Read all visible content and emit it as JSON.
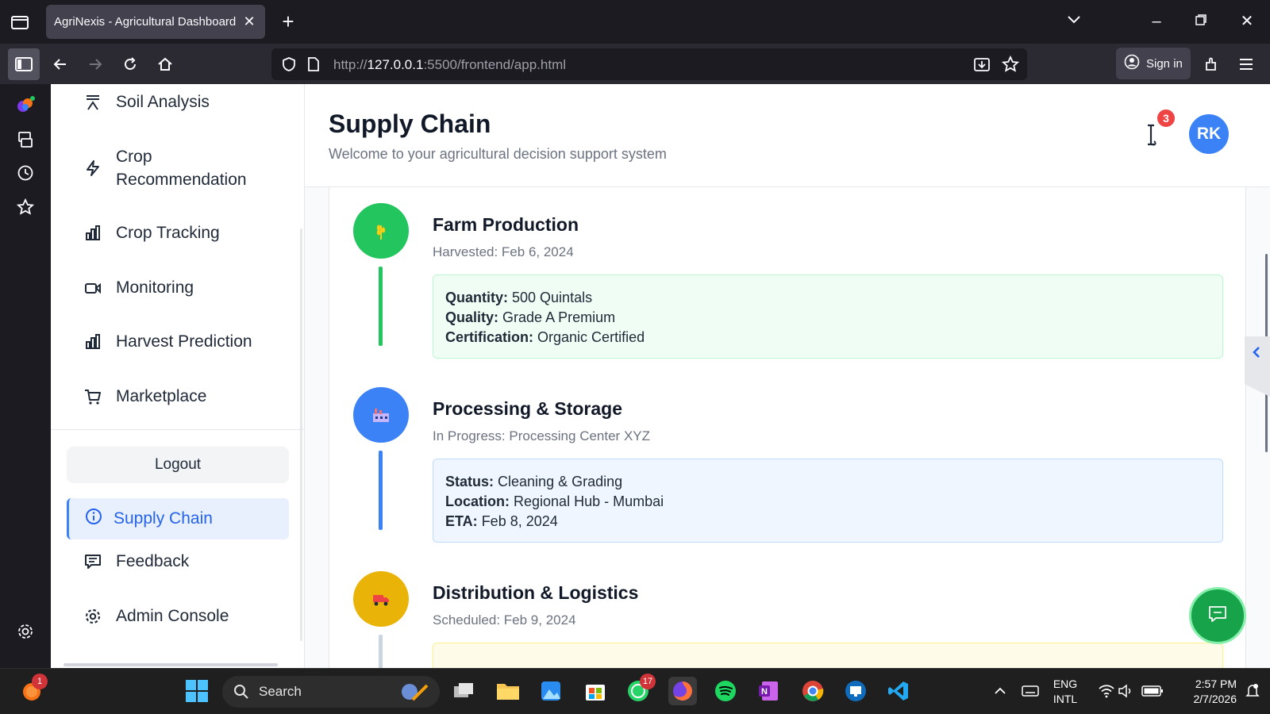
{
  "browser": {
    "tab_title": "AgriNexis - Agricultural Dashboard",
    "url_prefix": "http://",
    "url_host": "127.0.0.1",
    "url_rest": ":5500/frontend/app.html",
    "sign_in": "Sign in"
  },
  "sidebar": {
    "items": [
      {
        "label": "Soil Analysis",
        "icon": "soil-icon"
      },
      {
        "label": "Crop\nRecommendation",
        "icon": "lightning-icon"
      },
      {
        "label": "Crop Tracking",
        "icon": "bar-chart-icon"
      },
      {
        "label": "Monitoring",
        "icon": "video-icon"
      },
      {
        "label": "Harvest Prediction",
        "icon": "bar-chart-icon"
      },
      {
        "label": "Marketplace",
        "icon": "cart-icon"
      }
    ],
    "logout": "Logout",
    "active": "Supply Chain",
    "lower_items": [
      {
        "label": "Feedback",
        "icon": "message-icon"
      },
      {
        "label": "Admin Console",
        "icon": "gear-icon"
      }
    ]
  },
  "header": {
    "title": "Supply Chain",
    "subtitle": "Welcome to your agricultural decision support system",
    "notification_count": "3",
    "avatar_initials": "RK"
  },
  "stages": [
    {
      "title": "Farm Production",
      "subtitle": "Harvested: Feb 6, 2024",
      "color": "#22c55e",
      "box_bg": "#f0fdf4",
      "box_border": "#bbf7d0",
      "details": [
        {
          "k": "Quantity:",
          "v": "500 Quintals"
        },
        {
          "k": "Quality:",
          "v": "Grade A Premium"
        },
        {
          "k": "Certification:",
          "v": "Organic Certified"
        }
      ]
    },
    {
      "title": "Processing & Storage",
      "subtitle": "In Progress: Processing Center XYZ",
      "color": "#3b82f6",
      "box_bg": "#eff6ff",
      "box_border": "#bfdbfe",
      "details": [
        {
          "k": "Status:",
          "v": "Cleaning & Grading"
        },
        {
          "k": "Location:",
          "v": "Regional Hub - Mumbai"
        },
        {
          "k": "ETA:",
          "v": "Feb 8, 2024"
        }
      ]
    },
    {
      "title": "Distribution & Logistics",
      "subtitle": "Scheduled: Feb 9, 2024",
      "color": "#eab308",
      "box_bg": "#fefce8",
      "box_border": "#fef08a",
      "details": []
    }
  ],
  "taskbar": {
    "search": "Search",
    "lang_top": "ENG",
    "lang_bottom": "INTL",
    "time": "2:57 PM",
    "date": "2/7/2026",
    "whatsapp_badge": "17",
    "weather_badge": "1"
  }
}
